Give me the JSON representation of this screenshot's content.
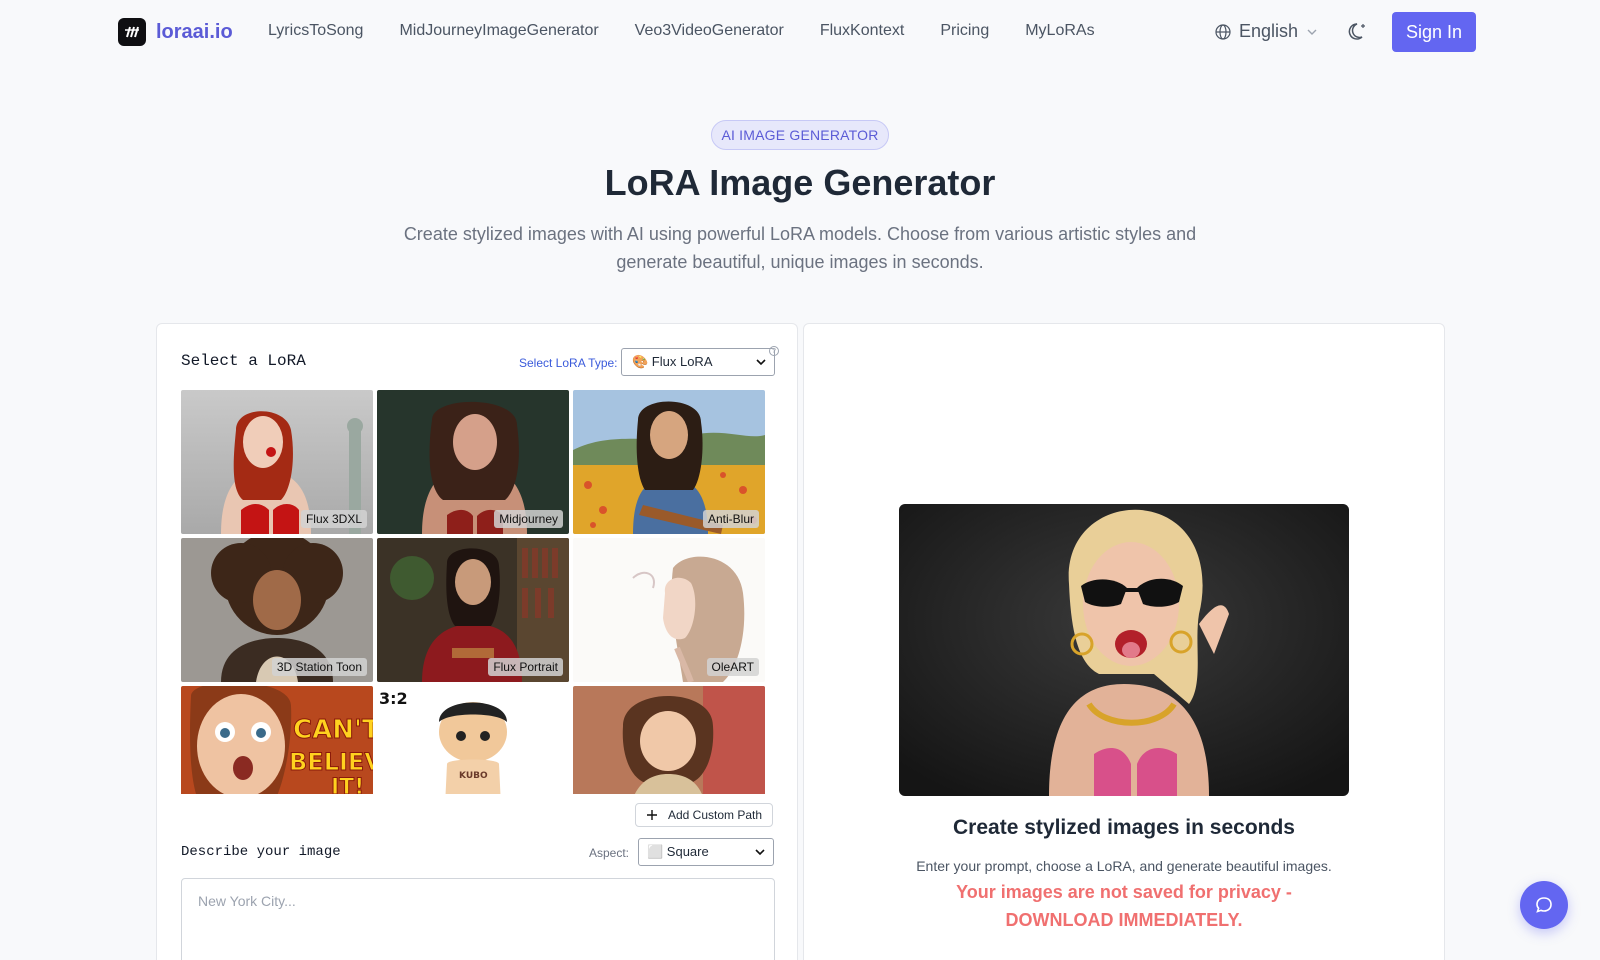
{
  "nav": {
    "logo_text": "loraai.io",
    "links": [
      "LyricsToSong",
      "MidJourneyImageGenerator",
      "Veo3VideoGenerator",
      "FluxKontext",
      "Pricing",
      "MyLoRAs"
    ],
    "language": "English",
    "sign_in": "Sign In"
  },
  "hero": {
    "badge": "AI IMAGE GENERATOR",
    "title": "LoRA Image Generator",
    "subtitle": "Create stylized images with AI using powerful LoRA models. Choose from various artistic styles and generate beautiful, unique images in seconds."
  },
  "lora_panel": {
    "title": "Select a LoRA",
    "type_label": "Select LoRA Type:",
    "type_value": "🎨 Flux LoRA",
    "tiles": [
      {
        "label": "Flux 3DXL"
      },
      {
        "label": "Midjourney"
      },
      {
        "label": "Anti-Blur"
      },
      {
        "label": "3D Station Toon"
      },
      {
        "label": "Flux Portrait"
      },
      {
        "label": "OleART"
      },
      {
        "label": "",
        "overlay_text": "CAN'T BELIEVE IT!"
      },
      {
        "label": "",
        "overlay_text": "3:2",
        "toy_text": "KUBO"
      },
      {
        "label": ""
      }
    ],
    "add_custom_path": "Add Custom Path",
    "describe_title": "Describe your image",
    "aspect_label": "Aspect:",
    "aspect_value": "⬜ Square",
    "prompt_placeholder": "New York City..."
  },
  "output_panel": {
    "title": "Create stylized images in seconds",
    "subtitle": "Enter your prompt, choose a LoRA, and generate beautiful images.",
    "warning": "Your images are not saved for privacy - DOWNLOAD IMMEDIATELY."
  },
  "colors": {
    "accent": "#6366f1",
    "warning": "#f07070",
    "badge_bg": "#e7e8fb"
  }
}
